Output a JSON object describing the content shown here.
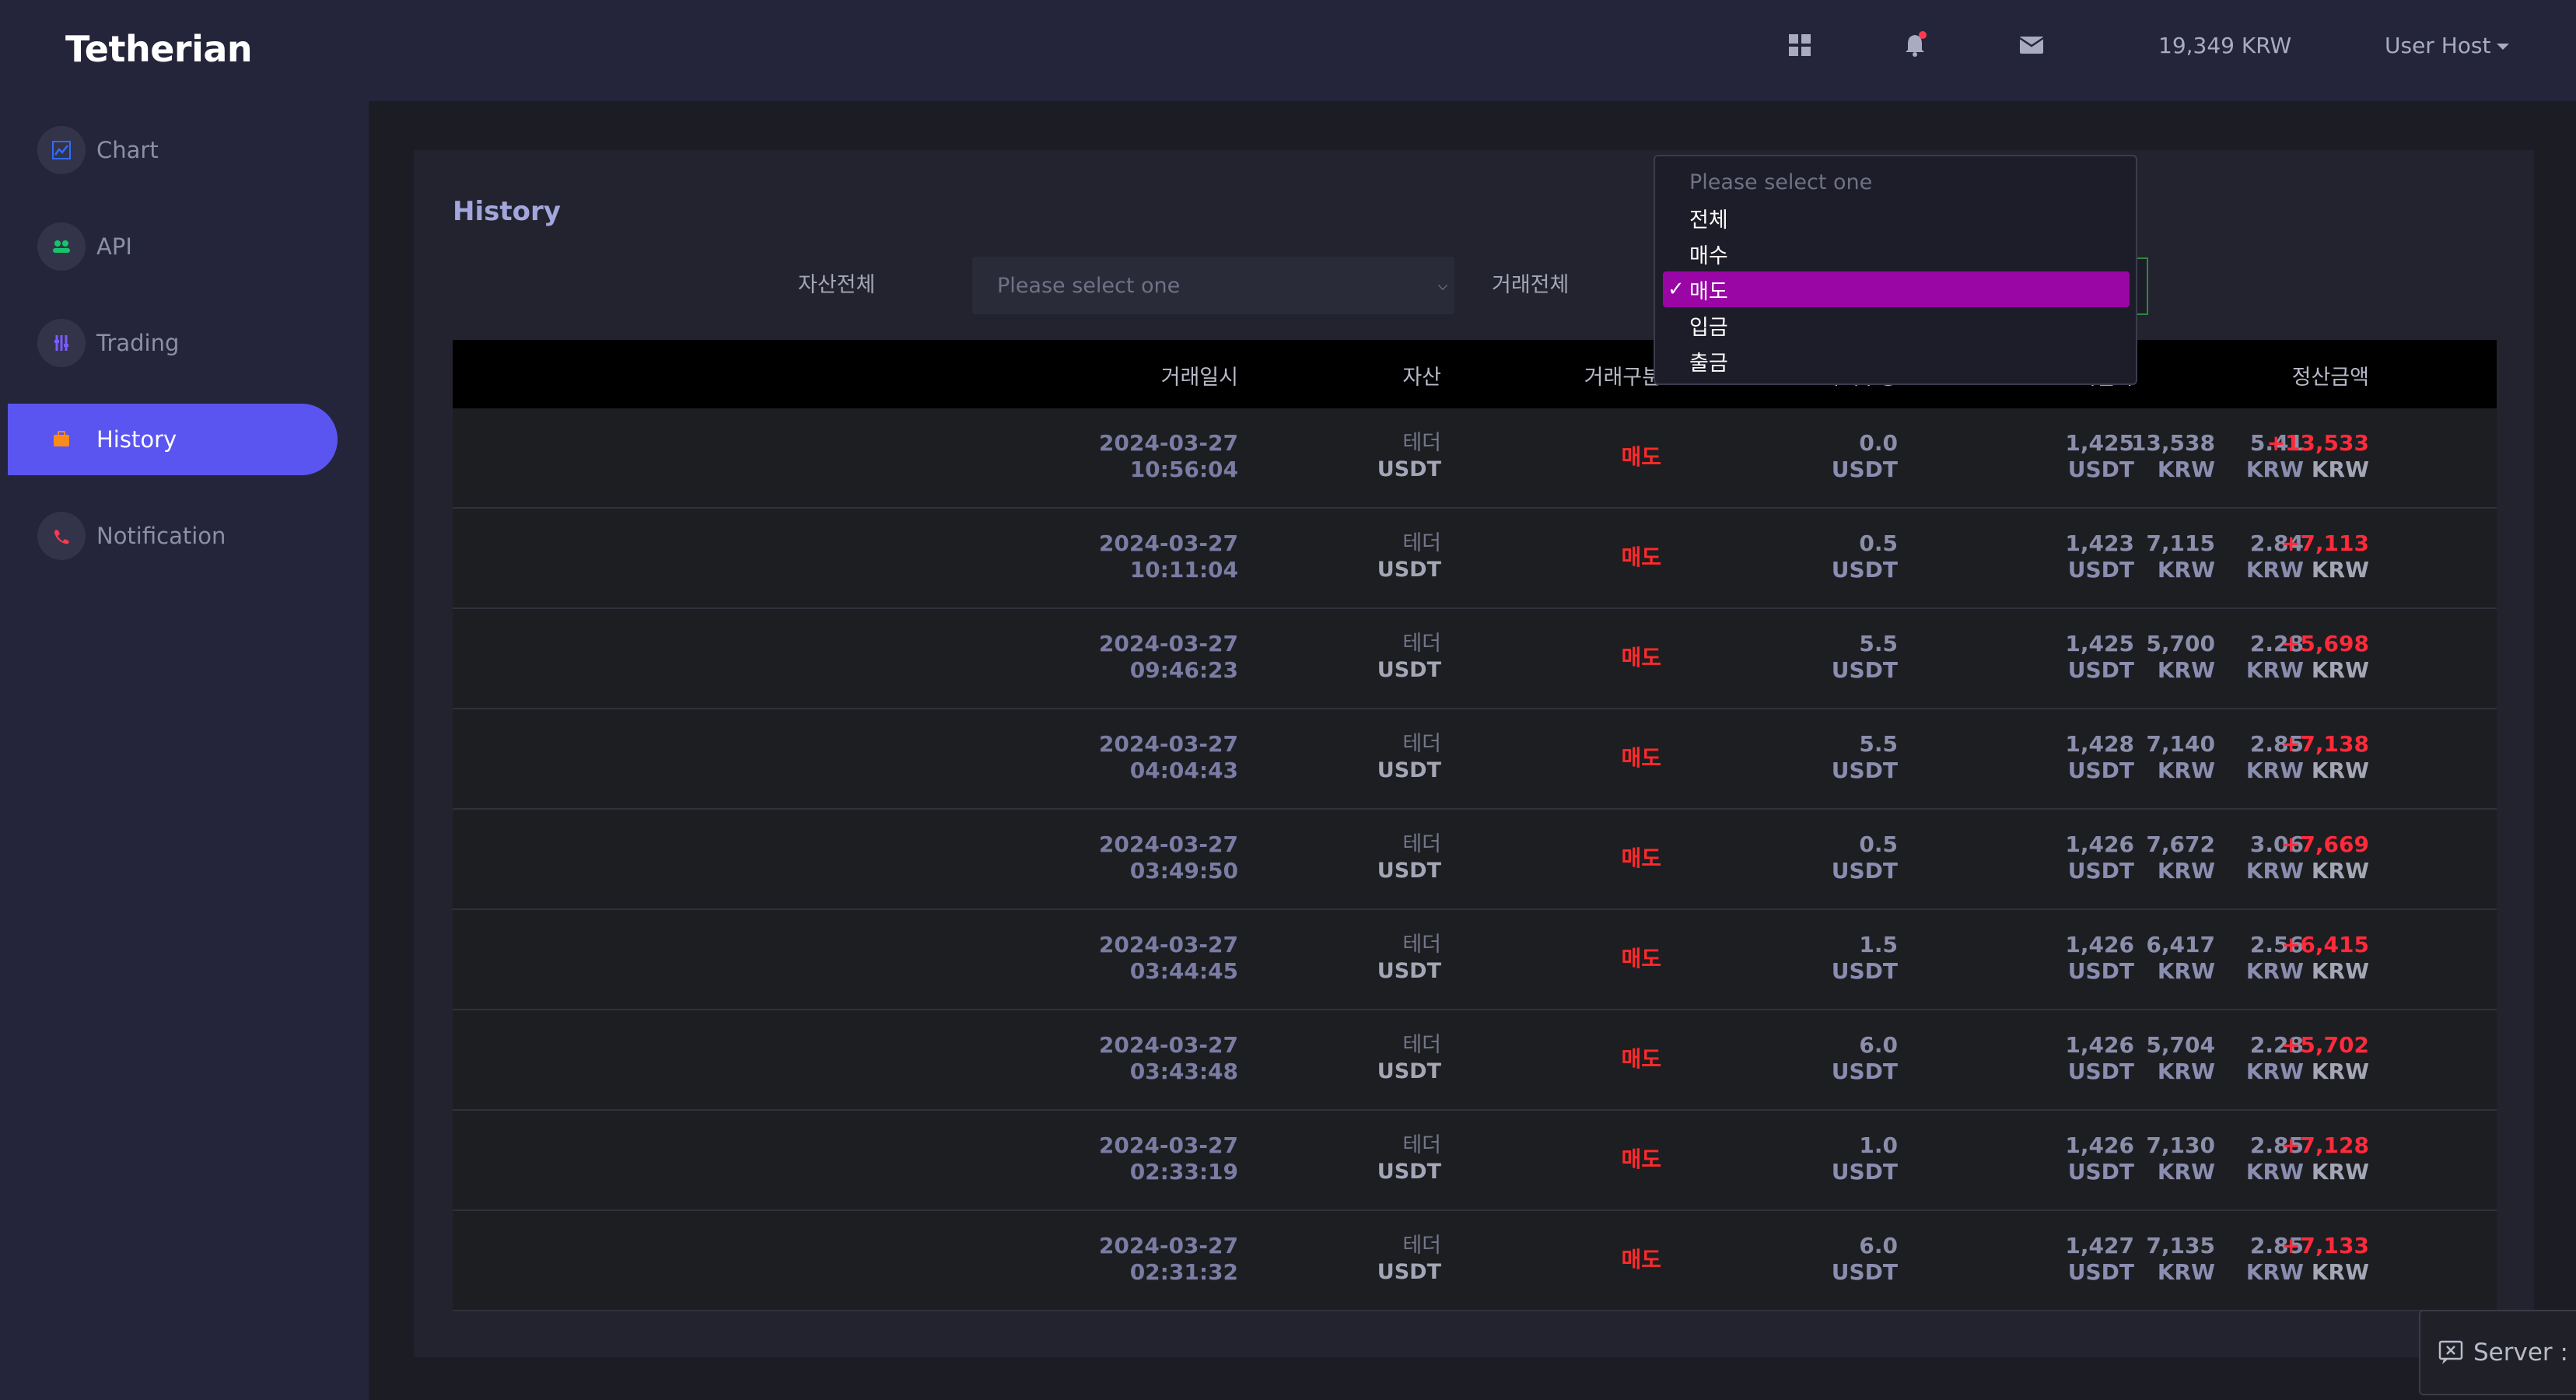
{
  "app": {
    "brand": "Tetherian"
  },
  "sidebar": {
    "items": [
      {
        "label": "Chart",
        "icon": "chart-icon",
        "color": "#2f6bff"
      },
      {
        "label": "API",
        "icon": "api-icon",
        "color": "#18c46b"
      },
      {
        "label": "Trading",
        "icon": "trading-icon",
        "color": "#7a5cff"
      },
      {
        "label": "History",
        "icon": "history-icon",
        "color": "#ff8a1c",
        "active": true
      },
      {
        "label": "Notification",
        "icon": "notification-icon",
        "color": "#ff3b4f"
      }
    ]
  },
  "header": {
    "balance": "19,349 KRW",
    "user": "User Host"
  },
  "main": {
    "title": "History",
    "filters": {
      "asset_label": "자산전체",
      "asset_placeholder": "Please select one",
      "trade_label": "거래전체"
    },
    "dropdown": {
      "placeholder": "Please select one",
      "options": [
        "전체",
        "매수",
        "매도",
        "입금",
        "출금"
      ],
      "selected": "매도"
    },
    "table": {
      "headers": [
        "거래일시",
        "자산",
        "거래구분",
        "거래수량",
        "체결가",
        "",
        "",
        "정산금액"
      ],
      "rows": [
        {
          "date": "2024-03-27",
          "time": "10:56:04",
          "asset": "테더",
          "asset_code": "USDT",
          "type": "매도",
          "qty": "0.0",
          "qty_unit": "USDT",
          "price": "1,425",
          "price_unit": "USDT",
          "amount": "13,538",
          "amount_unit": "KRW",
          "fee": "5.41",
          "fee_unit": "KRW",
          "settle": "+13,533",
          "settle_unit": "KRW"
        },
        {
          "date": "2024-03-27",
          "time": "10:11:04",
          "asset": "테더",
          "asset_code": "USDT",
          "type": "매도",
          "qty": "0.5",
          "qty_unit": "USDT",
          "price": "1,423",
          "price_unit": "USDT",
          "amount": "7,115",
          "amount_unit": "KRW",
          "fee": "2.84",
          "fee_unit": "KRW",
          "settle": "+7,113",
          "settle_unit": "KRW"
        },
        {
          "date": "2024-03-27",
          "time": "09:46:23",
          "asset": "테더",
          "asset_code": "USDT",
          "type": "매도",
          "qty": "5.5",
          "qty_unit": "USDT",
          "price": "1,425",
          "price_unit": "USDT",
          "amount": "5,700",
          "amount_unit": "KRW",
          "fee": "2.28",
          "fee_unit": "KRW",
          "settle": "+5,698",
          "settle_unit": "KRW"
        },
        {
          "date": "2024-03-27",
          "time": "04:04:43",
          "asset": "테더",
          "asset_code": "USDT",
          "type": "매도",
          "qty": "5.5",
          "qty_unit": "USDT",
          "price": "1,428",
          "price_unit": "USDT",
          "amount": "7,140",
          "amount_unit": "KRW",
          "fee": "2.85",
          "fee_unit": "KRW",
          "settle": "+7,138",
          "settle_unit": "KRW"
        },
        {
          "date": "2024-03-27",
          "time": "03:49:50",
          "asset": "테더",
          "asset_code": "USDT",
          "type": "매도",
          "qty": "0.5",
          "qty_unit": "USDT",
          "price": "1,426",
          "price_unit": "USDT",
          "amount": "7,672",
          "amount_unit": "KRW",
          "fee": "3.06",
          "fee_unit": "KRW",
          "settle": "+7,669",
          "settle_unit": "KRW"
        },
        {
          "date": "2024-03-27",
          "time": "03:44:45",
          "asset": "테더",
          "asset_code": "USDT",
          "type": "매도",
          "qty": "1.5",
          "qty_unit": "USDT",
          "price": "1,426",
          "price_unit": "USDT",
          "amount": "6,417",
          "amount_unit": "KRW",
          "fee": "2.56",
          "fee_unit": "KRW",
          "settle": "+6,415",
          "settle_unit": "KRW"
        },
        {
          "date": "2024-03-27",
          "time": "03:43:48",
          "asset": "테더",
          "asset_code": "USDT",
          "type": "매도",
          "qty": "6.0",
          "qty_unit": "USDT",
          "price": "1,426",
          "price_unit": "USDT",
          "amount": "5,704",
          "amount_unit": "KRW",
          "fee": "2.28",
          "fee_unit": "KRW",
          "settle": "+5,702",
          "settle_unit": "KRW"
        },
        {
          "date": "2024-03-27",
          "time": "02:33:19",
          "asset": "테더",
          "asset_code": "USDT",
          "type": "매도",
          "qty": "1.0",
          "qty_unit": "USDT",
          "price": "1,426",
          "price_unit": "USDT",
          "amount": "7,130",
          "amount_unit": "KRW",
          "fee": "2.85",
          "fee_unit": "KRW",
          "settle": "+7,128",
          "settle_unit": "KRW"
        },
        {
          "date": "2024-03-27",
          "time": "02:31:32",
          "asset": "테더",
          "asset_code": "USDT",
          "type": "매도",
          "qty": "6.0",
          "qty_unit": "USDT",
          "price": "1,427",
          "price_unit": "USDT",
          "amount": "7,135",
          "amount_unit": "KRW",
          "fee": "2.85",
          "fee_unit": "KRW",
          "settle": "+7,133",
          "settle_unit": "KRW"
        }
      ]
    }
  },
  "toast": {
    "text": "Server : C"
  },
  "colors": {
    "accent": "#5a55f0",
    "sell": "#ff2a2a",
    "selected_option": "#9a05a6"
  }
}
